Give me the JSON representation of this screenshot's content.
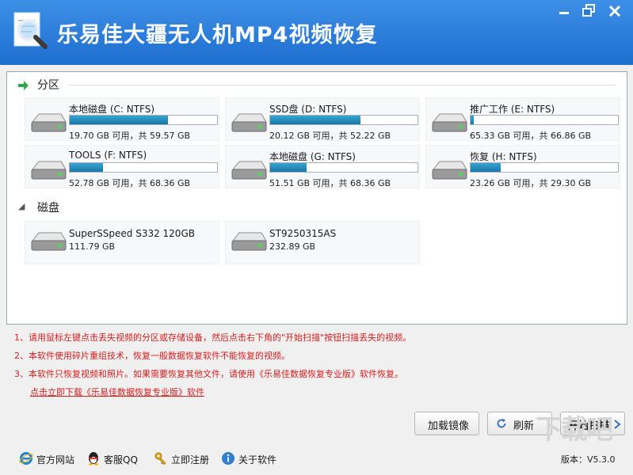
{
  "window": {
    "title": "乐易佳大疆无人机MP4视频恢复",
    "title_color": "#1e6fcf"
  },
  "partitions": {
    "section_title": "分区",
    "items": [
      {
        "name": "本地磁盘 (C: NTFS)",
        "info": "19.70 GB 可用，共 59.57 GB",
        "used_fraction": 0.669
      },
      {
        "name": "SSD盘 (D: NTFS)",
        "info": "20.12 GB 可用，共 52.22 GB",
        "used_fraction": 0.615
      },
      {
        "name": "推广工作 (E: NTFS)",
        "info": "65.33 GB 可用，共 66.86 GB",
        "used_fraction": 0.023
      },
      {
        "name": "TOOLS (F: NTFS)",
        "info": "52.78 GB 可用，共 68.36 GB",
        "used_fraction": 0.228
      },
      {
        "name": "本地磁盘 (G: NTFS)",
        "info": "51.51 GB 可用，共 68.36 GB",
        "used_fraction": 0.246
      },
      {
        "name": "恢复 (H: NTFS)",
        "info": "23.26 GB 可用，共 29.30 GB",
        "used_fraction": 0.206
      }
    ]
  },
  "disks": {
    "section_title": "磁盘",
    "items": [
      {
        "name": "SuperSSpeed S332 120GB",
        "info": "111.79 GB"
      },
      {
        "name": "ST9250315AS",
        "info": "232.89 GB"
      }
    ]
  },
  "notes": {
    "items": [
      "1、请用鼠标左键点击丢失视频的分区或存储设备，然后点击右下角的\"开始扫描\"按钮扫描丢失的视频。",
      "2、本软件使用碎片重组技术，恢复一般数据恢复软件不能恢复的视频。",
      "3、本软件只恢复视频和照片。如果需要恢复其他文件，请使用《乐易佳数据恢复专业版》软件恢复。"
    ],
    "link": "点击立即下载《乐易佳数据恢复专业版》软件",
    "color": "#d61e1e"
  },
  "buttons": {
    "load_image": "加载镜像",
    "refresh": "刷新",
    "start_scan": "开始扫描"
  },
  "footer": {
    "website": "官方网站",
    "qq": "客服QQ",
    "register": "立即注册",
    "about": "关于软件",
    "version_label": "版本：",
    "version_value": "V5.3.0"
  },
  "icons": {
    "app_logo": "magnifier-document-icon",
    "minimize": "minimize-icon",
    "restore": "restore-icon",
    "close": "close-icon",
    "drive": "hard-drive-icon",
    "refresh": "refresh-icon",
    "scan_arrow": "chevron-right-icon",
    "website": "ie-browser-icon",
    "qq": "qq-penguin-icon",
    "register": "key-icon",
    "about": "info-icon"
  }
}
